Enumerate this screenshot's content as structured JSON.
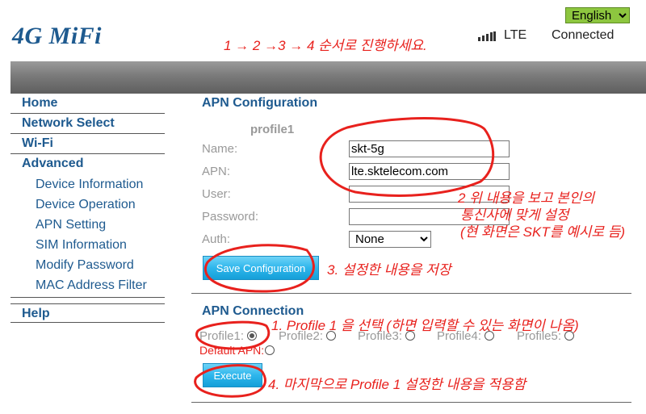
{
  "header": {
    "logo": "4G MiFi",
    "language": "English",
    "network_type": "LTE",
    "connection_status": "Connected",
    "signal_icon": "signal-bars-icon"
  },
  "sidebar": {
    "home": "Home",
    "network_select": "Network Select",
    "wifi": "Wi-Fi",
    "advanced": "Advanced",
    "advanced_items": [
      "Device Information",
      "Device Operation",
      "APN Setting",
      "SIM Information",
      "Modify Password",
      "MAC Address Filter"
    ],
    "help": "Help"
  },
  "apn_config": {
    "title": "APN Configuration",
    "profile": "profile1",
    "name_label": "Name:",
    "name_value": "skt-5g",
    "apn_label": "APN:",
    "apn_value": "lte.sktelecom.com",
    "user_label": "User:",
    "user_value": "",
    "password_label": "Password:",
    "password_value": "",
    "auth_label": "Auth:",
    "auth_value": "None",
    "save_button": "Save Configuration"
  },
  "apn_connection": {
    "title": "APN Connection",
    "profiles": [
      "Profile1:",
      "Profile2:",
      "Profile3:",
      "Profile4:",
      "Profile5:"
    ],
    "selected_profile": "Profile1",
    "default_apn": "Default APN:",
    "execute_button": "Execute"
  },
  "annotations": {
    "steps": "1 → 2 →3 → 4 순서로 진행하세요.",
    "step2_line1": "2 위 내용을 보고 본인의",
    "step2_line2": "통신사에 맞게 설정",
    "step2_line3": "(현 화면은 SKT를 예시로 듬)",
    "step3": "3. 설정한 내용을 저장",
    "step1": "1. Profile 1 을 선택 (하면 입력할 수 있는 화면이 나옴)",
    "step4": "4. 마지막으로 Profile 1 설정한 내용을 적용함",
    "color": "#e8211d"
  }
}
